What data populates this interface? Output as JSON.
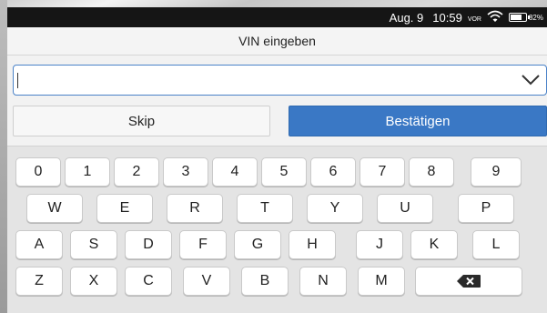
{
  "status": {
    "date": "Aug. 9",
    "time": "10:59",
    "am_pm": "VOR",
    "battery_percent": "82%",
    "battery_level": 0.82
  },
  "dialog": {
    "title": "VIN eingeben",
    "vin_value": "",
    "skip_label": "Skip",
    "confirm_label": "Bestätigen"
  },
  "keyboard": {
    "row1": [
      "0",
      "1",
      "2",
      "3",
      "4",
      "5",
      "6",
      "7",
      "8",
      "9"
    ],
    "row2": [
      "W",
      "E",
      "R",
      "T",
      "Y",
      "U",
      "P"
    ],
    "row3": [
      "A",
      "S",
      "D",
      "F",
      "G",
      "H",
      "J",
      "K",
      "L"
    ],
    "row4": [
      "Z",
      "X",
      "C",
      "V",
      "B",
      "N",
      "M"
    ],
    "backspace_icon": "backspace-icon"
  },
  "colors": {
    "accent": "#3a78c5",
    "field_border": "#4a82c8",
    "status_bar": "#151515"
  }
}
